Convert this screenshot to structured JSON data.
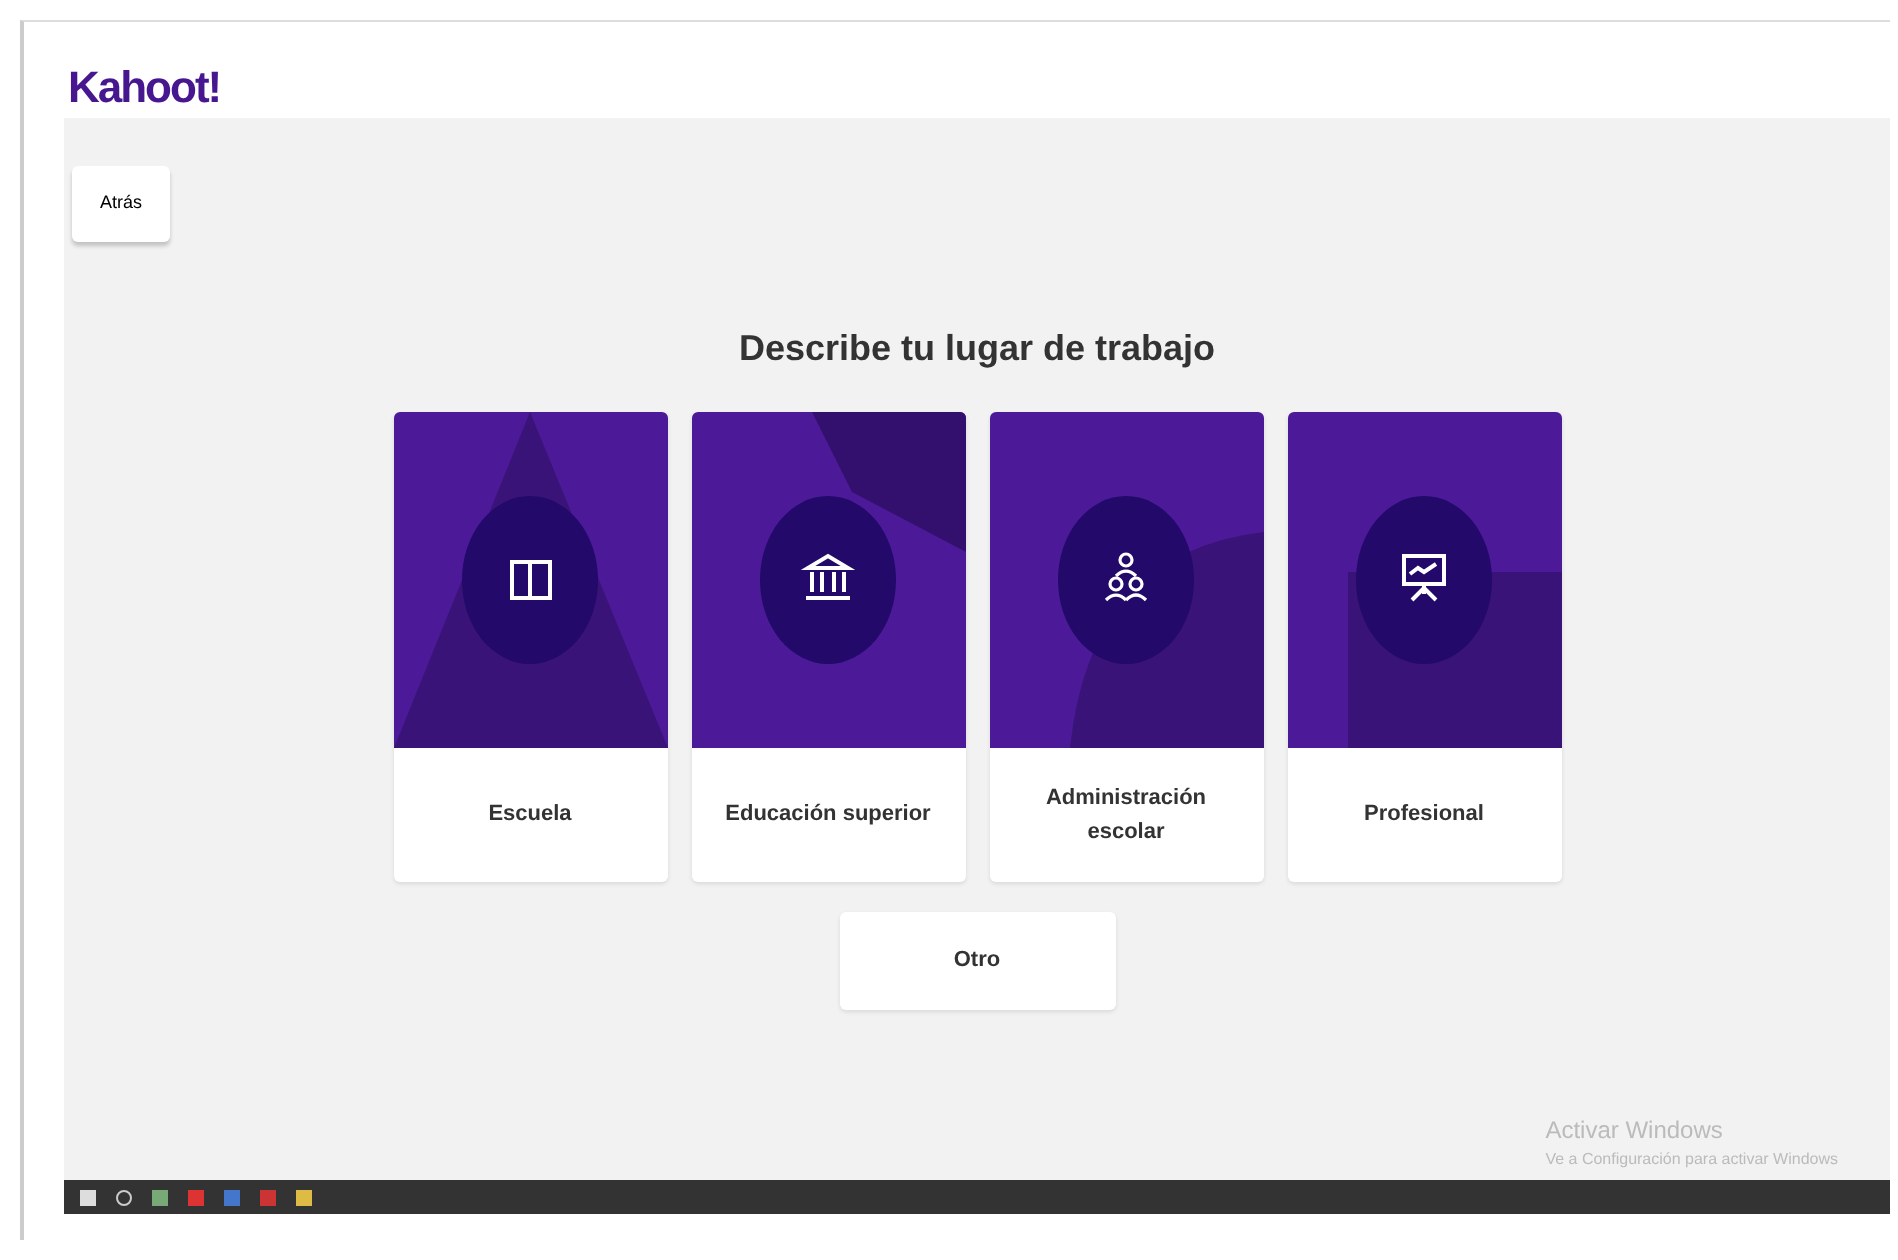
{
  "logo": "Kahoot!",
  "back_button": {
    "label": "Atrás"
  },
  "title": "Describe tu lugar de trabajo",
  "options": [
    {
      "kind": "book",
      "label": "Escuela"
    },
    {
      "kind": "building",
      "label": "Educación superior"
    },
    {
      "kind": "people",
      "label": "Administración escolar"
    },
    {
      "kind": "presentation",
      "label": "Profesional"
    }
  ],
  "other_button": {
    "label": "Otro"
  },
  "activation_notice": {
    "title": "Activar Windows",
    "text": "Ve a Configuración para activar Windows"
  }
}
